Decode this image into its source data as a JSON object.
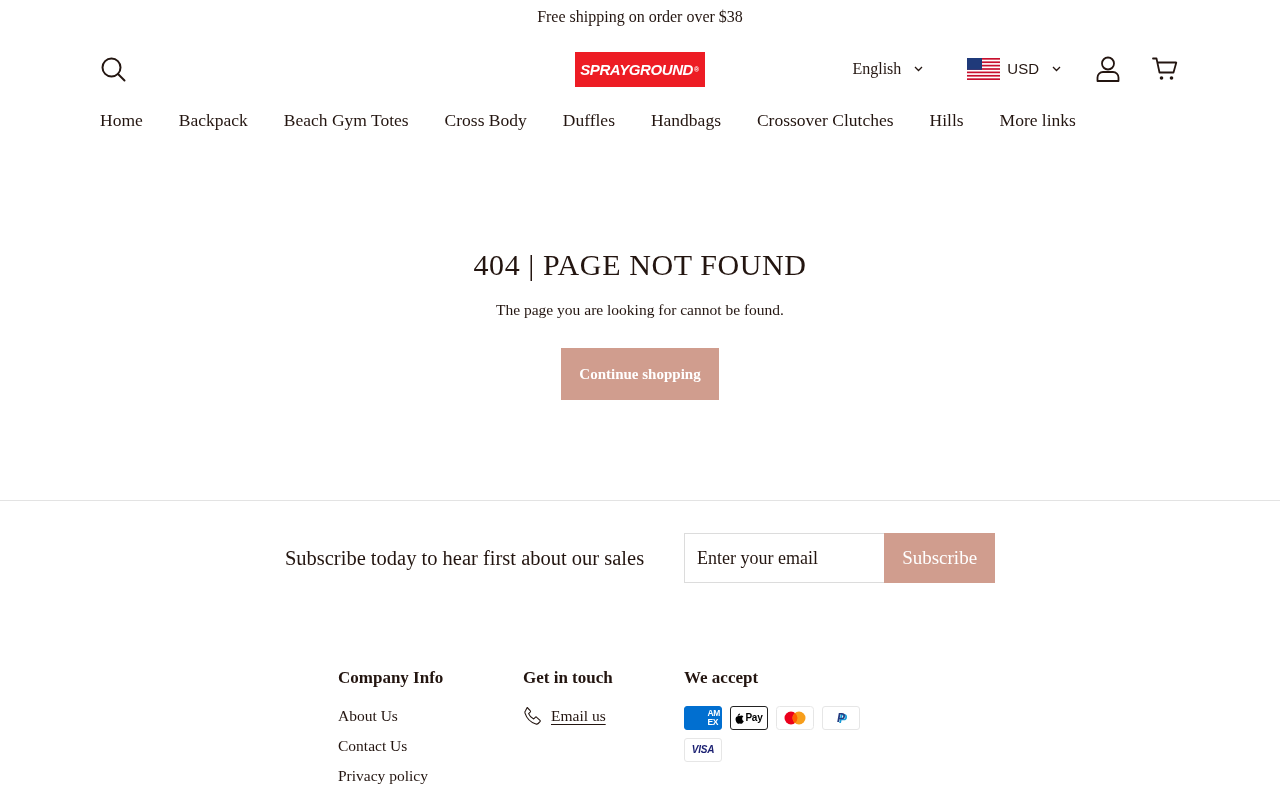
{
  "announcement": {
    "text": "Free shipping on order over $38"
  },
  "header": {
    "logo": {
      "text": "SPRAYGROUND$^{®}$"
    },
    "language": {
      "label": "English"
    },
    "currency": {
      "label": "USD"
    }
  },
  "nav": {
    "items": [
      "Home",
      "Backpack",
      "Beach Gym Totes",
      "Cross Body",
      "Duffles",
      "Handbags",
      "Crossover Clutches",
      "Hills",
      "More links"
    ]
  },
  "not_found": {
    "title": "404 | PAGE NOT FOUND",
    "message": "The page you are looking for cannot be found.",
    "button": "Continue shopping"
  },
  "newsletter": {
    "heading": "Subscribe today to hear first about our sales",
    "email": {
      "placeholder": "Enter your email"
    },
    "button": "Subscribe"
  },
  "footer": {
    "columns": [
      {
        "kind": "links",
        "heading": "Company Info",
        "links": [
          "About Us",
          "Contact Us",
          "Privacy policy"
        ]
      },
      {
        "kind": "contact",
        "heading": "Get in touch",
        "links": [
          "Email us"
        ]
      },
      {
        "kind": "payments",
        "heading": "We accept",
        "methods": [
          {
            "kind": "amex",
            "lines": [
              "AM",
              "EX"
            ]
          },
          {
            "kind": "applepay",
            "label": "Pay"
          },
          {
            "kind": "mastercard"
          },
          {
            "kind": "paypal",
            "label": "P"
          },
          {
            "kind": "visa",
            "label": "VISA"
          }
        ]
      }
    ]
  }
}
